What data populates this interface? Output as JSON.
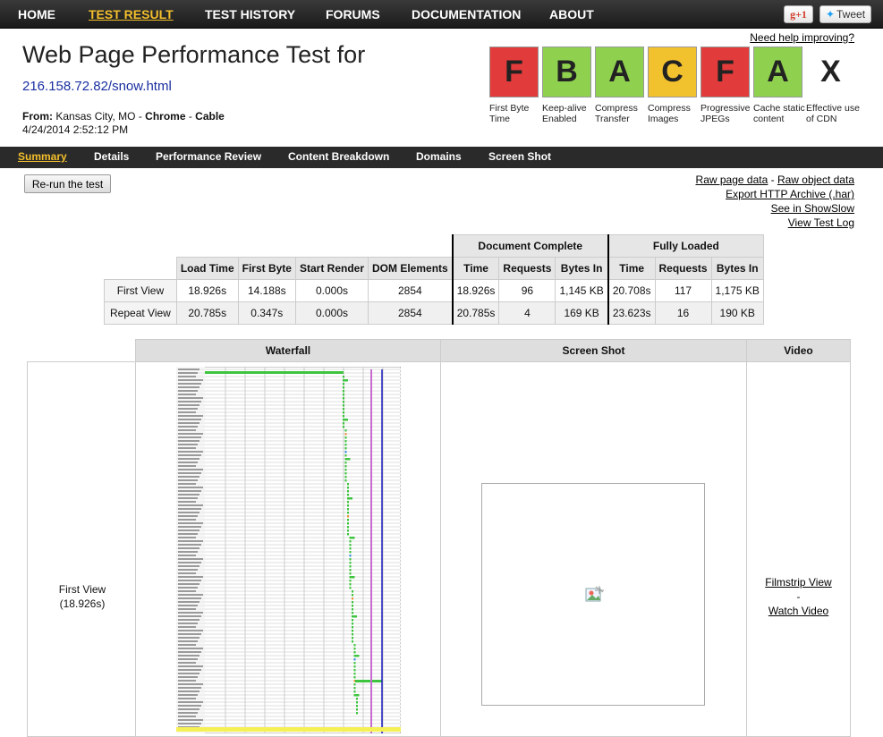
{
  "nav": {
    "items": [
      "HOME",
      "TEST RESULT",
      "TEST HISTORY",
      "FORUMS",
      "DOCUMENTATION",
      "ABOUT"
    ],
    "gplus": "g+1",
    "tweet": "Tweet"
  },
  "header": {
    "title": "Web Page Performance Test for",
    "url": "216.158.72.82/snow.html",
    "from_label": "From:",
    "from_location": "Kansas City, MO",
    "from_browser": "Chrome",
    "from_connection": "Cable",
    "date": "4/24/2014 2:52:12 PM",
    "help_link": "Need help improving?"
  },
  "grades": [
    {
      "letter": "F",
      "label": "First Byte Time",
      "color": "#e23b3b"
    },
    {
      "letter": "B",
      "label": "Keep-alive Enabled",
      "color": "#8fd14f"
    },
    {
      "letter": "A",
      "label": "Compress Transfer",
      "color": "#8fd14f"
    },
    {
      "letter": "C",
      "label": "Compress Images",
      "color": "#f2c12e"
    },
    {
      "letter": "F",
      "label": "Progressive JPEGs",
      "color": "#e23b3b"
    },
    {
      "letter": "A",
      "label": "Cache static content",
      "color": "#8fd14f"
    },
    {
      "letter": "X",
      "label": "Effective use of CDN",
      "color": "#ffffff"
    }
  ],
  "subnav": [
    "Summary",
    "Details",
    "Performance Review",
    "Content Breakdown",
    "Domains",
    "Screen Shot"
  ],
  "actions": {
    "rerun": "Re-run the test",
    "raw_page": "Raw page data",
    "dash": " - ",
    "raw_object": "Raw object data",
    "har": "Export HTTP Archive (.har)",
    "showslow": "See in ShowSlow",
    "log": "View Test Log"
  },
  "summary": {
    "group_doc": "Document Complete",
    "group_full": "Fully Loaded",
    "columns": [
      "Load Time",
      "First Byte",
      "Start Render",
      "DOM Elements",
      "Time",
      "Requests",
      "Bytes In",
      "Time",
      "Requests",
      "Bytes In"
    ],
    "rows": [
      {
        "label": "First View",
        "cells": [
          "18.926s",
          "14.188s",
          "0.000s",
          "2854",
          "18.926s",
          "96",
          "1,145 KB",
          "20.708s",
          "117",
          "1,175 KB"
        ]
      },
      {
        "label": "Repeat View",
        "cells": [
          "20.785s",
          "0.347s",
          "0.000s",
          "2854",
          "20.785s",
          "4",
          "169 KB",
          "23.623s",
          "16",
          "190 KB"
        ]
      }
    ]
  },
  "results": {
    "col_waterfall": "Waterfall",
    "col_screenshot": "Screen Shot",
    "col_video": "Video",
    "view_label": "First View",
    "view_time": "(18.926s)",
    "filmstrip": "Filmstrip View",
    "separator": "-",
    "watch": "Watch Video"
  }
}
